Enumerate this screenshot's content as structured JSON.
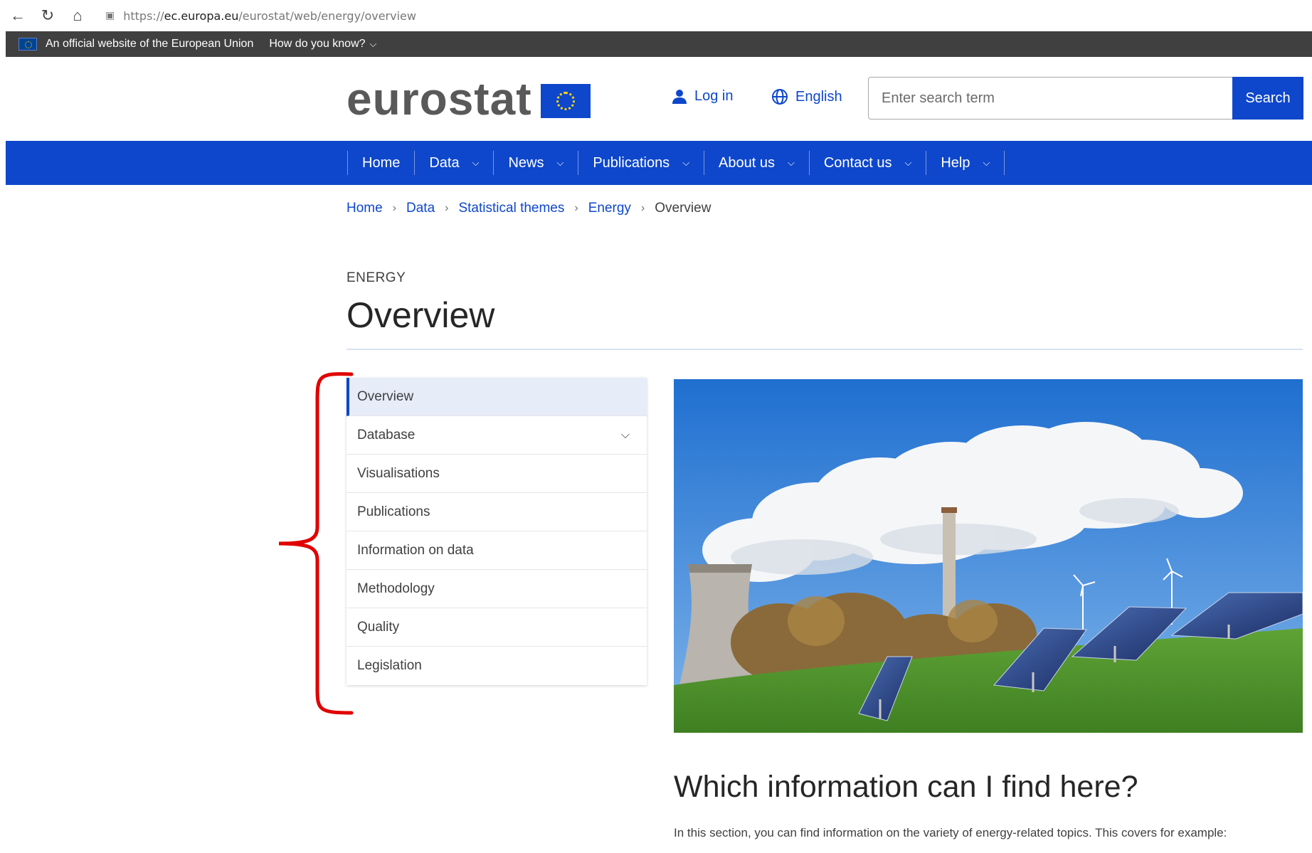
{
  "browser": {
    "url_prefix": "https://",
    "url_domain": "ec.europa.eu",
    "url_path": "/eurostat/web/energy/overview"
  },
  "eu_banner": {
    "text": "An official website of the European Union",
    "how_know": "How do you know?"
  },
  "header": {
    "logo_text": "eurostat",
    "login": "Log in",
    "language": "English",
    "search_placeholder": "Enter search term",
    "search_button": "Search"
  },
  "nav": {
    "items": [
      {
        "label": "Home",
        "dropdown": false
      },
      {
        "label": "Data",
        "dropdown": true
      },
      {
        "label": "News",
        "dropdown": true
      },
      {
        "label": "Publications",
        "dropdown": true
      },
      {
        "label": "About us",
        "dropdown": true
      },
      {
        "label": "Contact us",
        "dropdown": true
      },
      {
        "label": "Help",
        "dropdown": true
      }
    ]
  },
  "breadcrumb": {
    "items": [
      "Home",
      "Data",
      "Statistical themes",
      "Energy"
    ],
    "current": "Overview"
  },
  "page": {
    "kicker": "ENERGY",
    "title": "Overview"
  },
  "side_nav": {
    "items": [
      {
        "label": "Overview",
        "active": true,
        "expandable": false
      },
      {
        "label": "Database",
        "active": false,
        "expandable": true
      },
      {
        "label": "Visualisations",
        "active": false,
        "expandable": false
      },
      {
        "label": "Publications",
        "active": false,
        "expandable": false
      },
      {
        "label": "Information on data",
        "active": false,
        "expandable": false
      },
      {
        "label": "Methodology",
        "active": false,
        "expandable": false
      },
      {
        "label": "Quality",
        "active": false,
        "expandable": false
      },
      {
        "label": "Legislation",
        "active": false,
        "expandable": false
      }
    ]
  },
  "content": {
    "section_title": "Which information can I find here?",
    "section_text": "In this section, you can find information on the variety of energy-related topics. This covers for example:"
  },
  "colors": {
    "brand_blue": "#0e47cb",
    "banner_dark": "#404040",
    "annotation_red": "#e00000"
  },
  "icons": [
    "back-arrow-icon",
    "refresh-icon",
    "home-icon",
    "lock-icon",
    "eu-flag-icon",
    "chevron-down-icon",
    "user-icon",
    "globe-icon"
  ]
}
